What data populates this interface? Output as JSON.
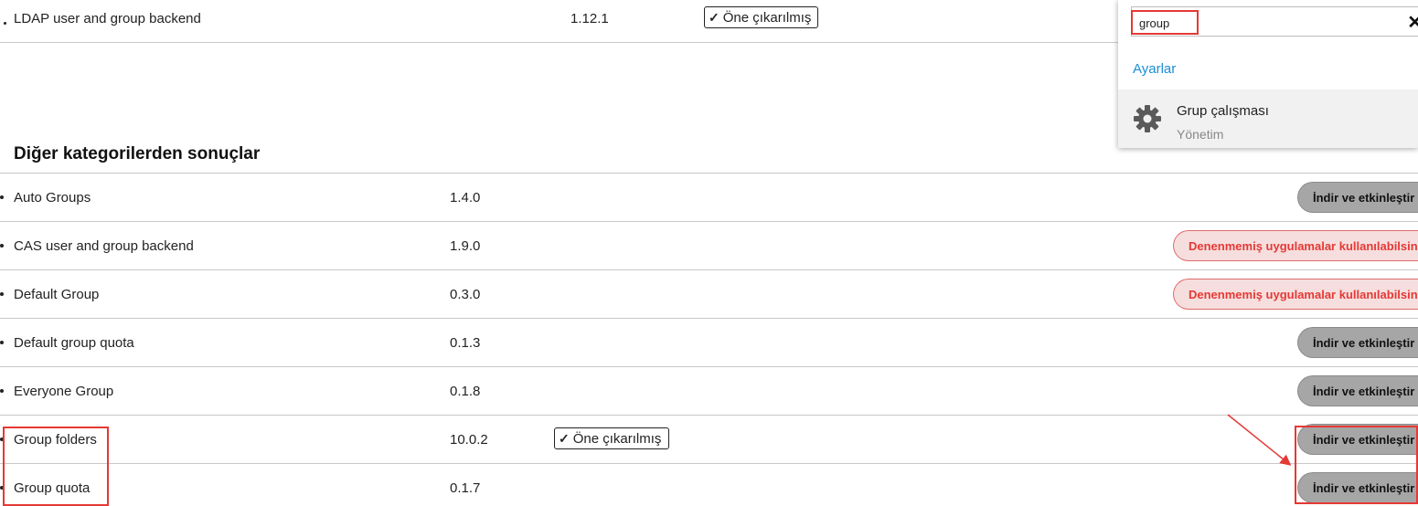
{
  "top_row": {
    "name": "LDAP user and group backend",
    "version": "1.12.1",
    "featured_label": "Öne çıkarılmış"
  },
  "section": {
    "title": "Diğer kategorilerden sonuçlar"
  },
  "rows": [
    {
      "name": "Auto Groups",
      "version": "1.4.0",
      "action": "İndir ve etkinleştir",
      "action_type": "gray"
    },
    {
      "name": "CAS user and group backend",
      "version": "1.9.0",
      "action": "Denenmemiş uygulamalar kullanılabilsin",
      "action_type": "red"
    },
    {
      "name": "Default Group",
      "version": "0.3.0",
      "action": "Denenmemiş uygulamalar kullanılabilsin",
      "action_type": "red"
    },
    {
      "name": "Default group quota",
      "version": "0.1.3",
      "action": "İndir ve etkinleştir",
      "action_type": "gray"
    },
    {
      "name": "Everyone Group",
      "version": "0.1.8",
      "action": "İndir ve etkinleştir",
      "action_type": "gray"
    },
    {
      "name": "Group folders",
      "version": "10.0.2",
      "featured_label": "Öne çıkarılmış",
      "action": "İndir ve etkinleştir",
      "action_type": "gray"
    },
    {
      "name": "Group quota",
      "version": "0.1.7",
      "action": "İndir ve etkinleştir",
      "action_type": "gray"
    }
  ],
  "search_popup": {
    "query": "group",
    "category": "Ayarlar",
    "result_title": "Grup çalışması",
    "result_subtitle": "Yönetim",
    "close_glyph": "✕"
  },
  "colors": {
    "accent_link": "#1a8fd6",
    "annotation": "#e53935",
    "button_gray": "#a6a6a6",
    "button_red_text": "#e53935"
  },
  "icons": {
    "check": "check-icon",
    "gear": "gear-icon",
    "close": "close-icon"
  }
}
